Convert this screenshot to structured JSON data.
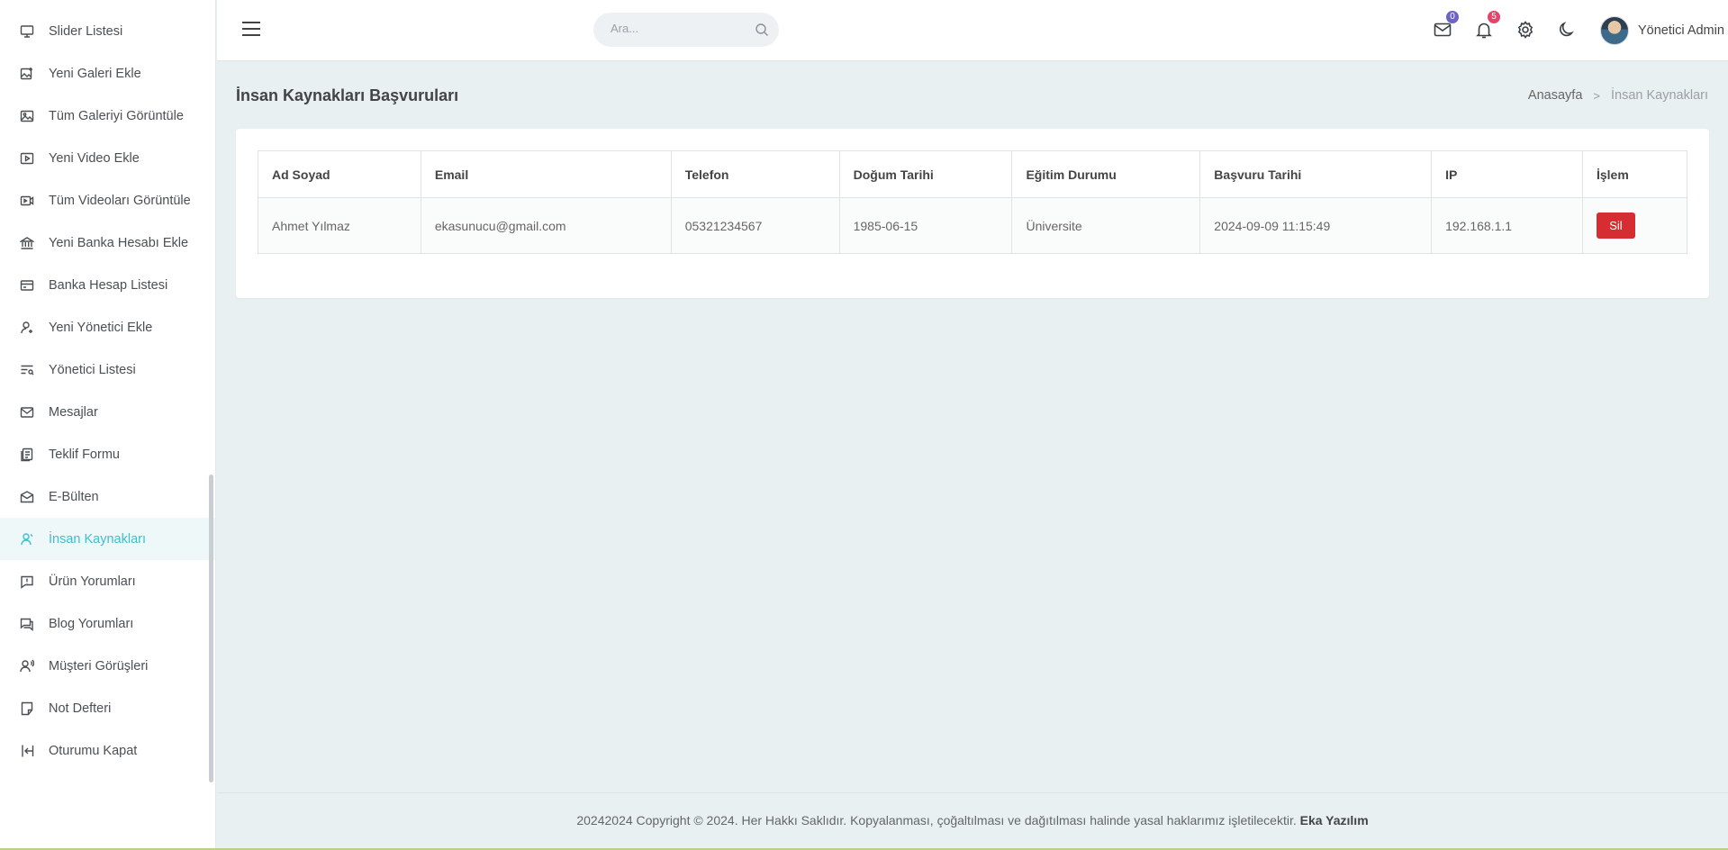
{
  "sidebar": {
    "items": [
      {
        "label": "Slider Listesi",
        "icon": "monitor-icon"
      },
      {
        "label": "Yeni Galeri Ekle",
        "icon": "gallery-add-icon"
      },
      {
        "label": "Tüm Galeriyi Görüntüle",
        "icon": "image-icon"
      },
      {
        "label": "Yeni Video Ekle",
        "icon": "video-add-icon"
      },
      {
        "label": "Tüm Videoları Görüntüle",
        "icon": "video-list-icon"
      },
      {
        "label": "Yeni Banka Hesabı Ekle",
        "icon": "bank-icon"
      },
      {
        "label": "Banka Hesap Listesi",
        "icon": "card-icon"
      },
      {
        "label": "Yeni Yönetici Ekle",
        "icon": "user-add-icon"
      },
      {
        "label": "Yönetici Listesi",
        "icon": "user-list-icon"
      },
      {
        "label": "Mesajlar",
        "icon": "mail-icon"
      },
      {
        "label": "Teklif Formu",
        "icon": "form-icon"
      },
      {
        "label": "E-Bülten",
        "icon": "newsletter-icon"
      },
      {
        "label": "İnsan Kaynakları",
        "icon": "hr-user-icon"
      },
      {
        "label": "Ürün Yorumları",
        "icon": "comment-alert-icon"
      },
      {
        "label": "Blog Yorumları",
        "icon": "comments-icon"
      },
      {
        "label": "Müşteri Görüşleri",
        "icon": "customer-voice-icon"
      },
      {
        "label": "Not Defteri",
        "icon": "note-icon"
      },
      {
        "label": "Oturumu Kapat",
        "icon": "logout-icon"
      }
    ],
    "active_index": 12
  },
  "header": {
    "search_placeholder": "Ara...",
    "mail_badge": "0",
    "notification_badge": "5",
    "user_name": "Yönetici Admin",
    "mail_badge_color": "#6c63c4",
    "notification_badge_color": "#e2456c"
  },
  "page": {
    "title": "İnsan Kaynakları Başvuruları",
    "breadcrumb": {
      "home": "Anasayfa",
      "current": "İnsan Kaynakları"
    }
  },
  "table": {
    "headers": [
      "Ad Soyad",
      "Email",
      "Telefon",
      "Doğum Tarihi",
      "Eğitim Durumu",
      "Başvuru Tarihi",
      "IP",
      "İşlem"
    ],
    "rows": [
      {
        "name": "Ahmet Yılmaz",
        "email": "ekasunucu@gmail.com",
        "phone": "05321234567",
        "birth_date": "1985-06-15",
        "education": "Üniversite",
        "apply_date": "2024-09-09 11:15:49",
        "ip": "192.168.1.1",
        "action_label": "Sil"
      }
    ]
  },
  "footer": {
    "text": "20242024 Copyright © 2024. Her Hakkı Saklıdır. Kopyalanması, çoğaltılması ve dağıtılması halinde yasal haklarımız işletilecektir.",
    "brand": "Eka Yazılım"
  }
}
